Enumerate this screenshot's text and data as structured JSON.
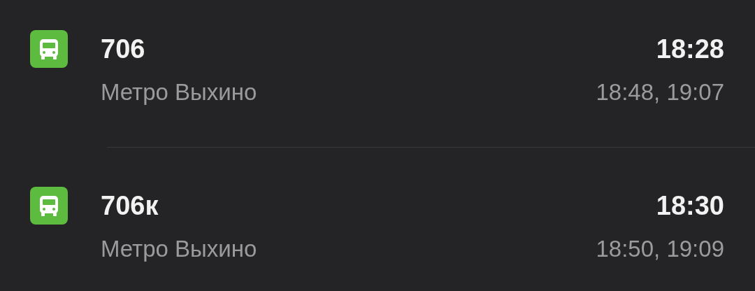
{
  "routes": [
    {
      "kind": "bus",
      "number": "706",
      "destination": "Метро Выхино",
      "next_time": "18:28",
      "later_times": "18:48, 19:07"
    },
    {
      "kind": "bus",
      "number": "706к",
      "destination": "Метро Выхино",
      "next_time": "18:30",
      "later_times": "18:50, 19:09"
    }
  ]
}
